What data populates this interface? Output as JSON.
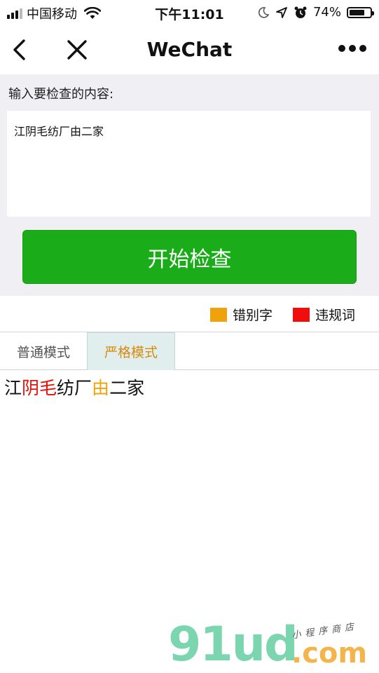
{
  "status_bar": {
    "carrier": "中国移动",
    "time": "下午11:01",
    "battery_text": "74%",
    "battery_level": 0.74
  },
  "nav": {
    "title": "WeChat"
  },
  "input": {
    "label": "输入要检查的内容:",
    "value": "江阴毛纺厂由二家"
  },
  "start_button_label": "开始检查",
  "legend": {
    "typo_label": "错别字",
    "typo_color": "#f0a20a",
    "banned_label": "违规词",
    "banned_color": "#f20d0d"
  },
  "tabs": {
    "normal": "普通模式",
    "strict": "严格模式",
    "active": "strict"
  },
  "result_segments": [
    {
      "text": "江",
      "type": "normal"
    },
    {
      "text": "阴毛",
      "type": "banned"
    },
    {
      "text": "纺厂",
      "type": "normal"
    },
    {
      "text": "由",
      "type": "typo"
    },
    {
      "text": "二家",
      "type": "normal"
    }
  ],
  "watermark": {
    "logo": "91ud",
    "domain": ".com",
    "tagline": "小程序商店"
  }
}
